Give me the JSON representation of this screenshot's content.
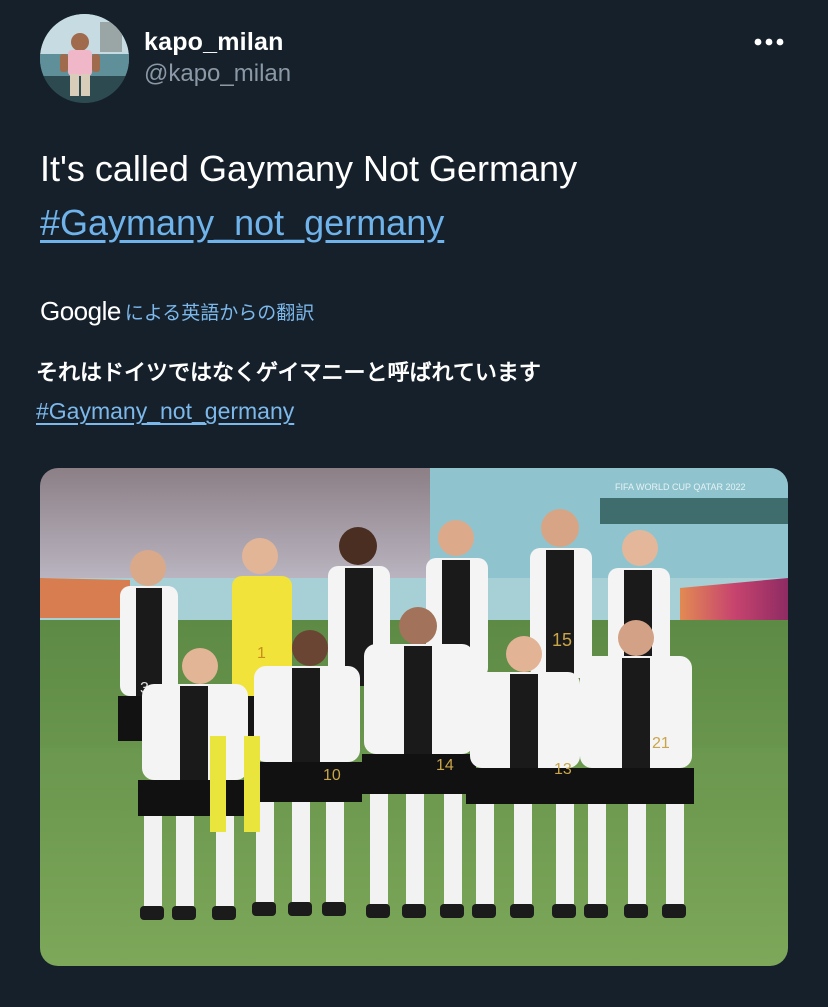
{
  "tweet": {
    "author": {
      "display_name": "kapo_milan",
      "handle": "@kapo_milan",
      "avatar_icon": "profile-photo"
    },
    "more_icon": "more-horizontal-icon",
    "text": {
      "main_line": "It's called Gaymany Not Germany",
      "hashtag": "#Gaymany_not_germany"
    },
    "translation": {
      "provider_logo": "Google",
      "link_label": "による英語からの翻訳",
      "translated_line": "それはドイツではなくゲイマニーと呼ばれています",
      "translated_hashtag": "#Gaymany_not_germany"
    },
    "media": {
      "kind": "photo",
      "banner_text": "FIFA WORLD CUP QATAR 2022",
      "jersey_numbers": [
        "3",
        "1",
        "15",
        "10",
        "14",
        "13",
        "21"
      ]
    },
    "colors": {
      "background": "#15202b",
      "link": "#6fb3ea",
      "secondary_text": "#8b98a5"
    }
  }
}
